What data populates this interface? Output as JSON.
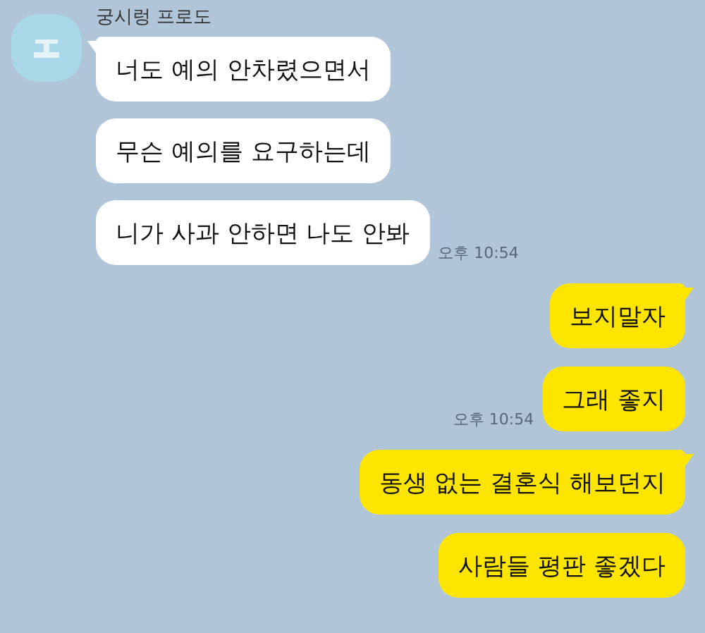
{
  "sender": {
    "name": "궁시렁 프로도"
  },
  "messages": [
    {
      "kind": "received",
      "text": "너도 예의 안차렸으면서",
      "tail": true
    },
    {
      "kind": "received",
      "text": "무슨 예의를 요구하는데",
      "tail": false
    },
    {
      "kind": "received",
      "text": "니가 사과 안하면 나도 안봐",
      "tail": false,
      "time": "오후 10:54"
    },
    {
      "kind": "sent",
      "text": "보지말자",
      "tail": true
    },
    {
      "kind": "sent",
      "text": "그래 좋지",
      "tail": false,
      "time": "오후 10:54"
    },
    {
      "kind": "sent",
      "text": "동생 없는 결혼식 해보던지",
      "tail": true
    },
    {
      "kind": "sent",
      "text": "사람들 평판 좋겠다",
      "tail": false
    }
  ]
}
